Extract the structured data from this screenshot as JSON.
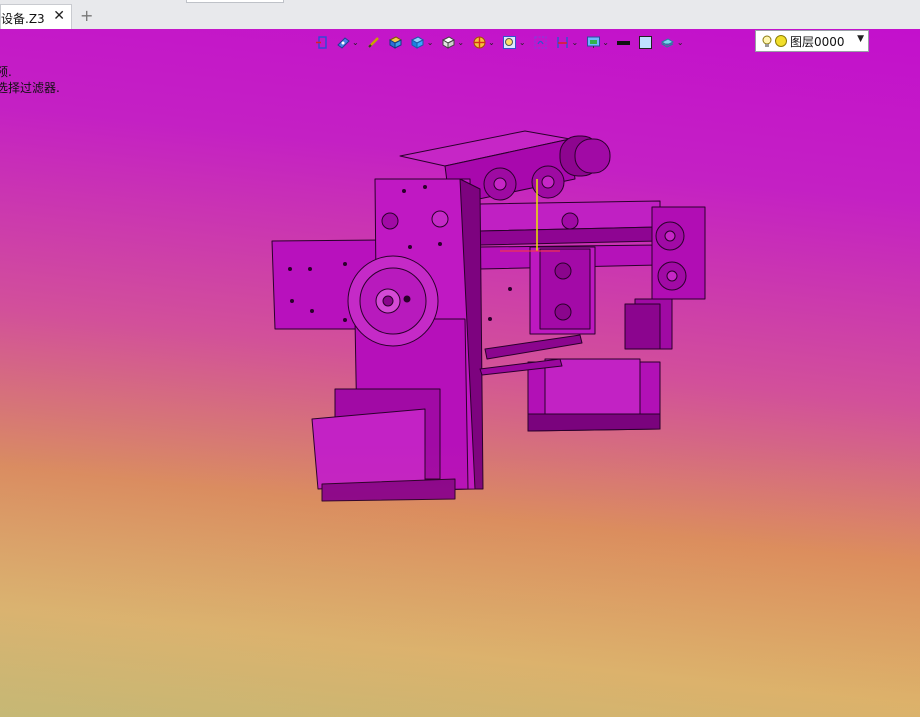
{
  "tab": {
    "title": "设备.Z3",
    "close_glyph": "✕",
    "add_glyph": "+"
  },
  "messages": {
    "line1": "预.",
    "line2": "选择过滤器."
  },
  "toolbar": {
    "buttons": [
      {
        "icon": "exit-sketch-icon"
      },
      {
        "icon": "view-orientation-icon",
        "dropdown": true
      },
      {
        "icon": "pencil-icon"
      },
      {
        "icon": "shaded-solid-icon"
      },
      {
        "icon": "display-mode-icon",
        "dropdown": true
      },
      {
        "icon": "standard-views-cube-icon",
        "dropdown": true
      },
      {
        "icon": "section-view-icon",
        "dropdown": true
      },
      {
        "icon": "zoom-icon",
        "dropdown": true
      },
      {
        "icon": "rotate-view-icon"
      },
      {
        "icon": "inquire-icon",
        "dropdown": true
      },
      {
        "icon": "background-icon",
        "dropdown": true
      },
      {
        "icon": "line-style-icon"
      },
      {
        "icon": "color-swatch-icon"
      },
      {
        "icon": "layer-icon",
        "dropdown": true
      }
    ],
    "dropdown_glyph": "⌄"
  },
  "layer": {
    "current": "图层0000",
    "arrow": "▼"
  },
  "colors": {
    "model": "#b30ab8",
    "model_light": "#c626c6",
    "model_dark": "#7e0482",
    "edge": "#2a002b"
  }
}
